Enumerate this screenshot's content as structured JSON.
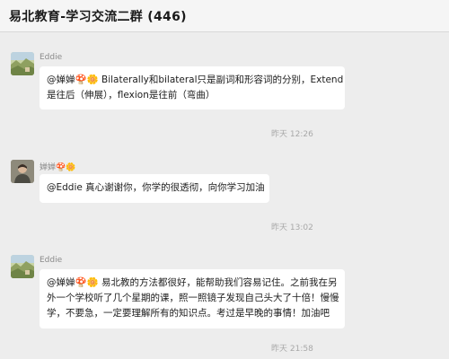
{
  "window": {
    "title": "易北教育-学习交流二群 (446)"
  },
  "messages": [
    {
      "sender": "Eddie",
      "lines": [
        "@婵婵🍄🌼 Bilaterally和bilateral只是副词和形容词的分别，Extend",
        "是往后（伸展），flexion是往前（弯曲）"
      ],
      "time": "昨天 12:26"
    },
    {
      "sender": "婵婵🍄🌼",
      "lines": [
        "@Eddie 真心谢谢你，你学的很透彻，向你学习加油"
      ],
      "time": "昨天 13:02"
    },
    {
      "sender": "Eddie",
      "lines": [
        "@婵婵🍄🌼 易北教的方法都很好，能帮助我们容易记住。之前我在另",
        "外一个学校听了几个星期的课，照一照镜子发现自己头大了十倍！慢慢",
        "学，不要急，一定要理解所有的知识点。考过是早晚的事情！加油吧"
      ],
      "time": "昨天 21:58"
    }
  ],
  "icons": {
    "avatar_eddie": "landscape-avatar-icon",
    "avatar_chanchan": "person-avatar-icon"
  },
  "colors": {
    "background": "#ededed",
    "bubble": "#ffffff",
    "meta_text": "#a8a8a8"
  }
}
